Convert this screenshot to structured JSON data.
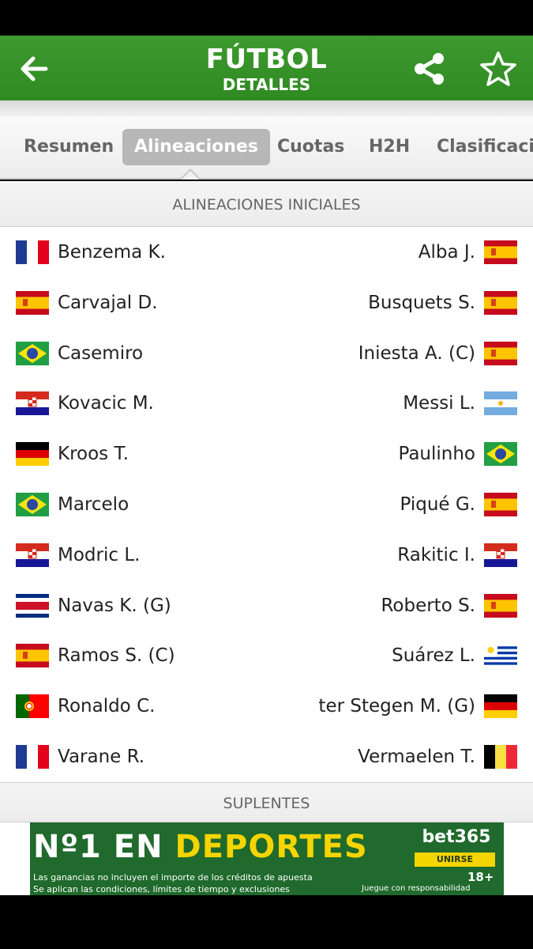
{
  "header": {
    "title": "FÚTBOL",
    "subtitle": "DETALLES"
  },
  "tabs": [
    {
      "label": "Resumen",
      "active": false
    },
    {
      "label": "Alineaciones",
      "active": true
    },
    {
      "label": "Cuotas",
      "active": false
    },
    {
      "label": "H2H",
      "active": false
    },
    {
      "label": "Clasificación",
      "active": false
    }
  ],
  "sections": {
    "starting": "ALINEACIONES INICIALES",
    "subs": "SUPLENTES"
  },
  "lineup": {
    "home": [
      {
        "name": "Benzema K.",
        "flag": "france"
      },
      {
        "name": "Carvajal D.",
        "flag": "spain"
      },
      {
        "name": "Casemiro",
        "flag": "brazil"
      },
      {
        "name": "Kovacic M.",
        "flag": "croatia"
      },
      {
        "name": "Kroos T.",
        "flag": "germany"
      },
      {
        "name": "Marcelo",
        "flag": "brazil"
      },
      {
        "name": "Modric L.",
        "flag": "croatia"
      },
      {
        "name": "Navas K. (G)",
        "flag": "costa-rica"
      },
      {
        "name": "Ramos S. (C)",
        "flag": "spain"
      },
      {
        "name": "Ronaldo C.",
        "flag": "portugal"
      },
      {
        "name": "Varane R.",
        "flag": "france"
      }
    ],
    "away": [
      {
        "name": "Alba J.",
        "flag": "spain"
      },
      {
        "name": "Busquets S.",
        "flag": "spain"
      },
      {
        "name": "Iniesta A. (C)",
        "flag": "spain"
      },
      {
        "name": "Messi L.",
        "flag": "argentina"
      },
      {
        "name": "Paulinho",
        "flag": "brazil"
      },
      {
        "name": "Piqué G.",
        "flag": "spain"
      },
      {
        "name": "Rakitic I.",
        "flag": "croatia"
      },
      {
        "name": "Roberto S.",
        "flag": "spain"
      },
      {
        "name": "Suárez L.",
        "flag": "uruguay"
      },
      {
        "name": "ter Stegen M. (G)",
        "flag": "germany"
      },
      {
        "name": "Vermaelen T.",
        "flag": "belgium"
      }
    ]
  },
  "ad": {
    "headline_white": "Nº1 EN ",
    "headline_yellow": "DEPORTES",
    "brand": "bet365",
    "cta": "UNIRSE",
    "age": "18+",
    "fine_print_1": "Las ganancias no incluyen el importe de los créditos de apuesta",
    "fine_print_2": "Se aplican las condiciones, límites de tiempo y exclusiones",
    "fine_print_3": "Juegue con responsabilidad"
  },
  "colors": {
    "header_green": "#3d9a2e",
    "ad_green": "#1f6a2c",
    "ad_yellow": "#f5d400"
  }
}
